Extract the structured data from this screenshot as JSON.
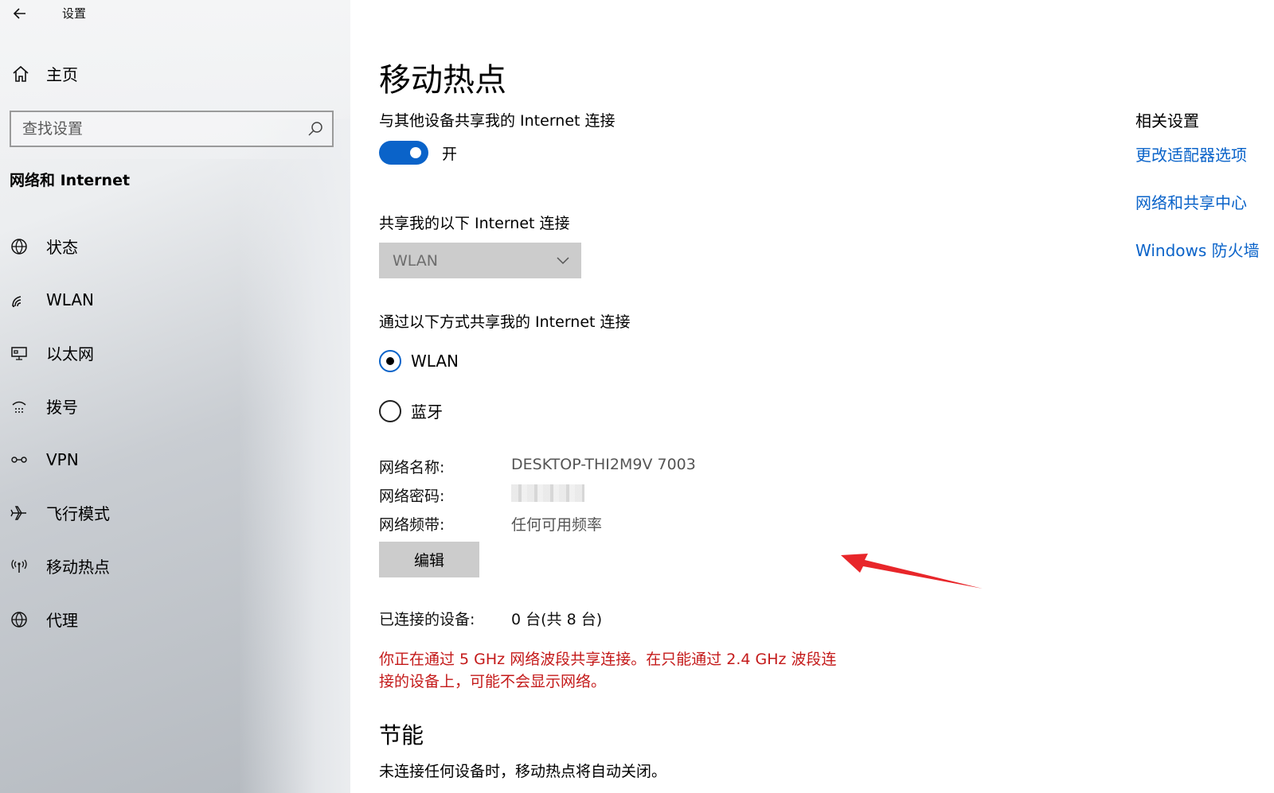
{
  "app": {
    "title": "设置"
  },
  "sidebar": {
    "home_label": "主页",
    "search": {
      "placeholder": "查找设置"
    },
    "section_title": "网络和 Internet",
    "items": [
      {
        "label": "状态",
        "icon": "globe-status-icon"
      },
      {
        "label": "WLAN",
        "icon": "wifi-icon"
      },
      {
        "label": "以太网",
        "icon": "ethernet-icon"
      },
      {
        "label": "拨号",
        "icon": "dialup-icon"
      },
      {
        "label": "VPN",
        "icon": "vpn-icon"
      },
      {
        "label": "飞行模式",
        "icon": "airplane-icon"
      },
      {
        "label": "移动热点",
        "icon": "hotspot-icon"
      },
      {
        "label": "代理",
        "icon": "globe-icon"
      }
    ]
  },
  "main": {
    "title": "移动热点",
    "share_label": "与其他设备共享我的 Internet 连接",
    "toggle": {
      "state": "开",
      "on": true
    },
    "share_from_label": "共享我的以下 Internet 连接",
    "share_from_value": "WLAN",
    "share_via_label": "通过以下方式共享我的 Internet 连接",
    "radio_options": [
      {
        "label": "WLAN",
        "checked": true
      },
      {
        "label": "蓝牙",
        "checked": false
      }
    ],
    "network_name_label": "网络名称:",
    "network_name_value": "DESKTOP-THI2M9V 7003",
    "network_password_label": "网络密码:",
    "network_band_label": "网络频带:",
    "network_band_value": "任何可用频率",
    "edit_button": "编辑",
    "connected_label": "已连接的设备:",
    "connected_value": "0 台(共 8 台)",
    "warning_line1": "你正在通过 5 GHz 网络波段共享连接。在只能通过 2.4 GHz 波段连",
    "warning_line2": "接的设备上，可能不会显示网络。",
    "power_title": "节能",
    "power_text": "未连接任何设备时，移动热点将自动关闭。"
  },
  "related": {
    "title": "相关设置",
    "links": [
      "更改适配器选项",
      "网络和共享中心",
      "Windows 防火墙"
    ]
  },
  "colors": {
    "accent": "#0a63c9",
    "warning": "#c41a1a",
    "arrow": "#e8262a"
  }
}
